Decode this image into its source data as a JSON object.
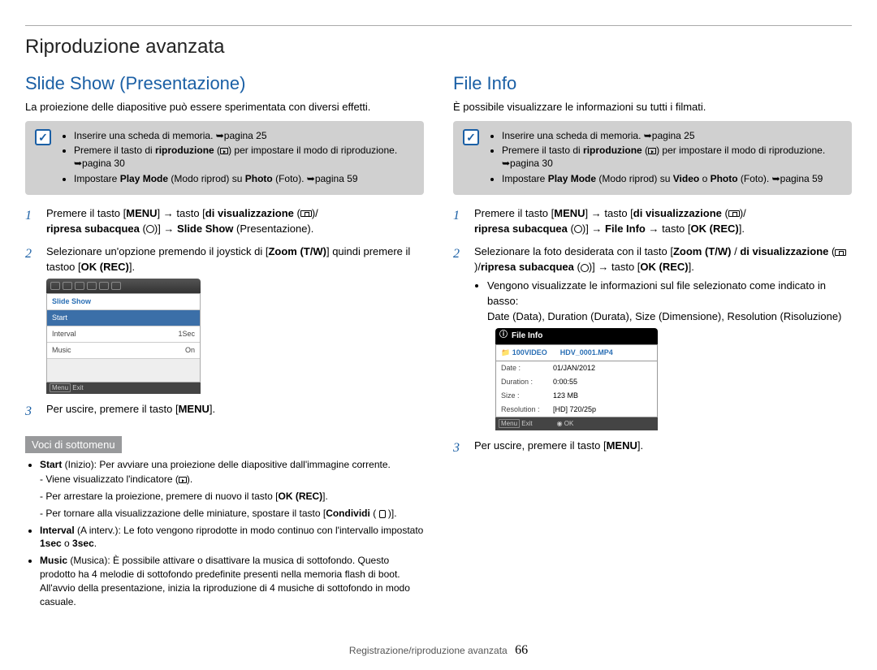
{
  "page_title": "Riproduzione avanzata",
  "footer_label": "Registrazione/riproduzione avanzata",
  "page_number": "66",
  "left": {
    "heading": "Slide Show (Presentazione)",
    "intro": "La proiezione delle diapositive può essere sperimentata con diversi effetti.",
    "notes": {
      "n1": "Inserire una scheda di memoria. ➥pagina 25",
      "n2a": "Premere il tasto di ",
      "n2b": "riproduzione",
      "n2c": " per impostare il modo di riproduzione. ➥pagina 30",
      "n3a": "Impostare ",
      "n3b": "Play Mode",
      "n3c": " (Modo riprod) su ",
      "n3d": "Photo",
      "n3e": " (Foto). ➥pagina 59"
    },
    "step1": {
      "a": "Premere il tasto [",
      "menu": "MENU",
      "b": "] → tasto [",
      "disp": "di visualizzazione",
      "c": "ripresa subacquea",
      "d": "] → ",
      "ss": "Slide Show",
      "e": " (Presentazione)."
    },
    "step2": {
      "a": "Selezionare un'opzione premendo il joystick di [",
      "z": "Zoom (T/W)",
      "b": "] quindi premere il tastoo [",
      "ok": "OK (REC)",
      "c": "]."
    },
    "menu_box": {
      "title": "Slide Show",
      "r1a": "Start",
      "r2a": "Interval",
      "r2b": "1Sec",
      "r3a": "Music",
      "r3b": "On",
      "exit": "Exit"
    },
    "step3": {
      "a": "Per uscire, premere il tasto [",
      "menu": "MENU",
      "b": "]."
    },
    "voci_head": "Voci di sottomenu",
    "voci": {
      "start": {
        "a": "Start",
        "b": " (Inizio): Per avviare una proiezione delle diapositive dall'immagine corrente.",
        "s1": "Viene visualizzato l'indicatore (",
        "s2": "Per arrestare la proiezione, premere di nuovo il tasto [",
        "ok": "OK (REC)",
        "s2b": "].",
        "s3a": "Per tornare alla visualizzazione delle miniature, spostare il tasto [",
        "s3bold": "Condividi",
        "s3b": " ( ",
        "s3c": " )]."
      },
      "interval": {
        "a": "Interval",
        "b": " (A interv.): Le foto vengono riprodotte in modo continuo con l'intervallo impostato ",
        "c": "1sec",
        "d": " o ",
        "e": "3sec",
        "f": "."
      },
      "music": {
        "a": "Music",
        "b": " (Musica): È possibile attivare o disattivare la musica di sottofondo. Questo prodotto ha 4 melodie di sottofondo predefinite presenti nella memoria flash di boot. All'avvio della presentazione, inizia la riproduzione di 4  musiche di sottofondo in modo casuale."
      }
    }
  },
  "right": {
    "heading": "File Info",
    "intro": "È possibile visualizzare le informazioni su tutti i filmati.",
    "notes": {
      "n1": "Inserire una scheda di memoria. ➥pagina 25",
      "n2a": "Premere il tasto di ",
      "n2b": "riproduzione",
      "n2c": " per impostare il modo di riproduzione. ➥pagina 30",
      "n3a": "Impostare ",
      "n3b": "Play Mode",
      "n3c": " (Modo riprod) su ",
      "n3d": "Video",
      "n3e": " o ",
      "n3f": "Photo",
      "n3g": " (Foto). ➥pagina 59"
    },
    "step1": {
      "a": "Premere il tasto [",
      "menu": "MENU",
      "b": "] → tasto [",
      "disp": "di visualizzazione",
      "c": "ripresa subacquea",
      "d": "] → ",
      "fi": "File Info",
      "e": " → tasto [",
      "ok": "OK (REC)",
      "f": "]."
    },
    "step2": {
      "a": "Selezionare la foto desiderata con il tasto [",
      "z": "Zoom (T/W)",
      "b": " / ",
      "disp": "di visualizzazione",
      "c": "/",
      "uw": "ripresa subacquea",
      "d": "] → tasto [",
      "ok": "OK (REC)",
      "e": "].",
      "bul1": "Vengono visualizzate le informazioni sul file selezionato come indicato in basso:",
      "bul2": "Date (Data), Duration (Durata), Size (Dimensione), Resolution (Risoluzione)"
    },
    "fi_box": {
      "title": "File Info",
      "folder": "100VIDEO",
      "file": "HDV_0001.MP4",
      "rows": {
        "date_l": "Date",
        "date_v": "01/JAN/2012",
        "dur_l": "Duration",
        "dur_v": "0:00:55",
        "size_l": "Size",
        "size_v": "123 MB",
        "res_l": "Resolution",
        "res_v": "[HD] 720/25p"
      },
      "exit": "Exit",
      "ok": "OK"
    },
    "step3": {
      "a": "Per uscire, premere il tasto [",
      "menu": "MENU",
      "b": "]."
    }
  }
}
